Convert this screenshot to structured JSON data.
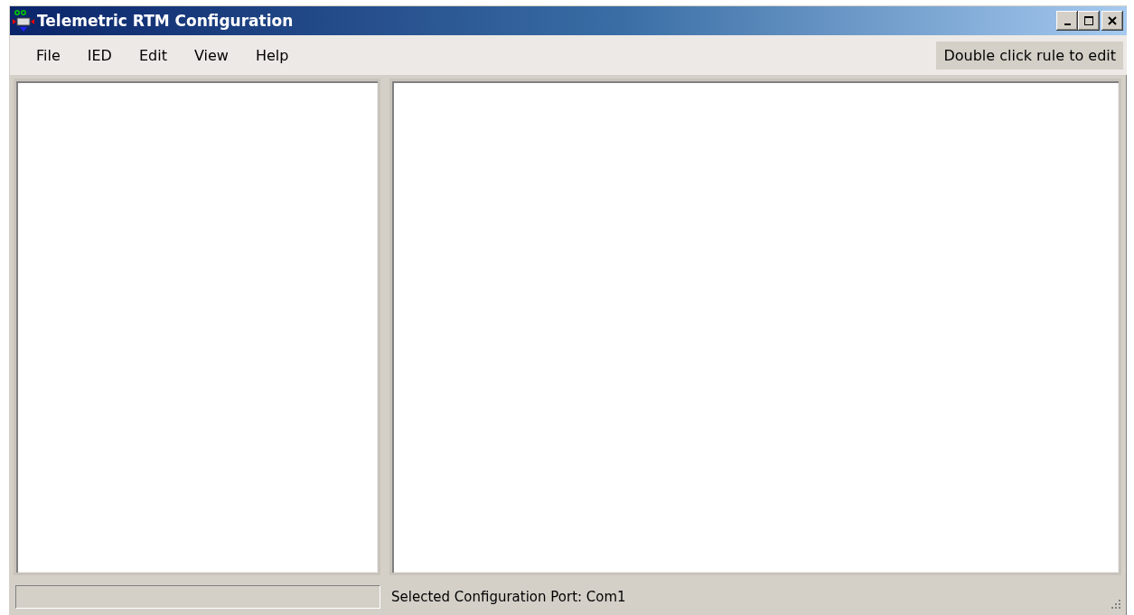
{
  "window": {
    "title": "Telemetric RTM Configuration"
  },
  "menu": [
    "File",
    "IED",
    "Edit",
    "View",
    "Help"
  ],
  "hint": "Double click rule to edit",
  "status_bar": {
    "port": "Selected Configuration Port: Com1"
  }
}
